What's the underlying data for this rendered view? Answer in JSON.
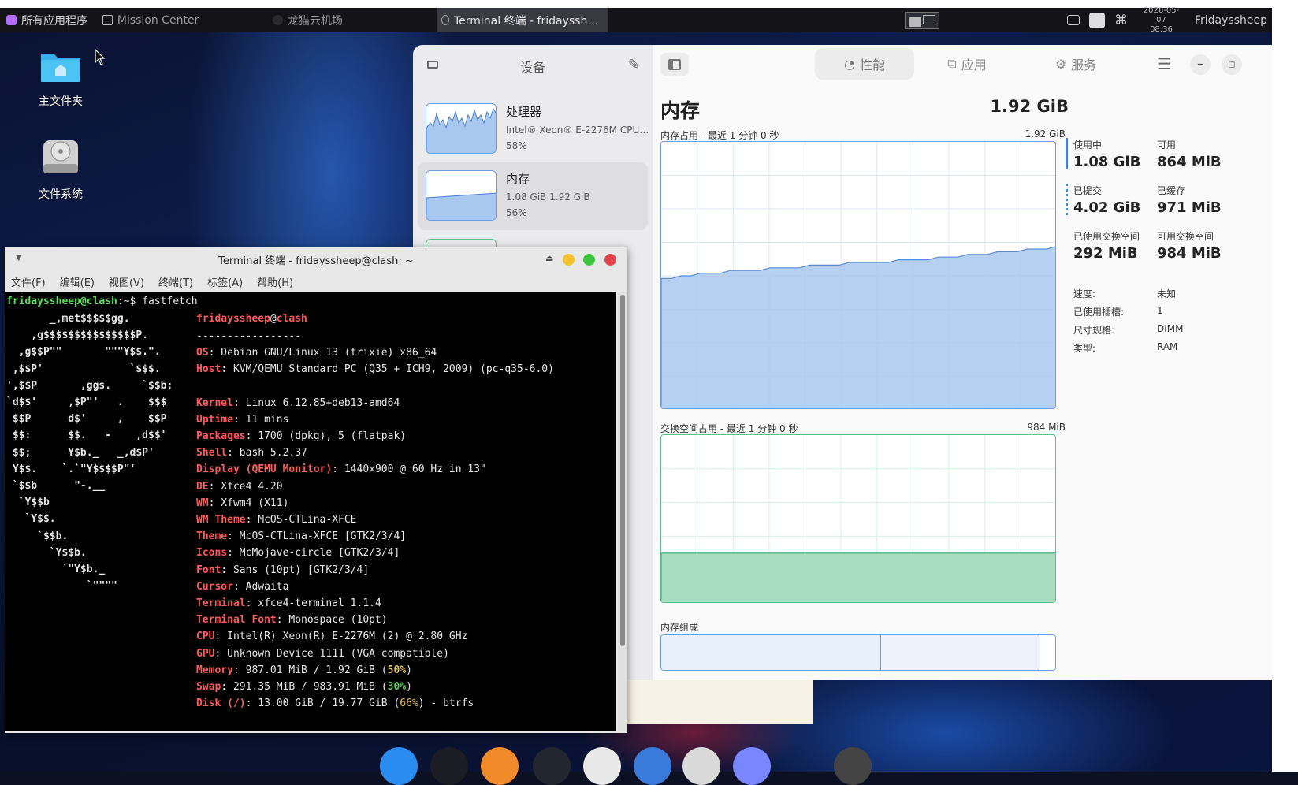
{
  "top_panel": {
    "apps_menu": "所有应用程序",
    "tasks": [
      {
        "label": "Mission Center"
      },
      {
        "label": "龙猫云机场"
      },
      {
        "label": "Terminal 终端 - fridayssheep@clash: ~"
      }
    ],
    "clock": {
      "date": "2026-05-07",
      "time": "08:36"
    },
    "user": "Fridayssheep"
  },
  "desktop": {
    "icons": [
      {
        "label": "主文件夹",
        "icon": "folder-home-icon"
      },
      {
        "label": "文件系统",
        "icon": "drive-icon"
      }
    ]
  },
  "mission_center": {
    "sidebar": {
      "title": "设备",
      "devices": [
        {
          "name": "处理器",
          "line1": "Intel® Xeon® E-2276M CPU…",
          "line2": "58%"
        },
        {
          "name": "内存",
          "line1": "1.08 GiB 1.92 GiB",
          "line2": "56%"
        }
      ]
    },
    "tabs": [
      {
        "label": "性能",
        "icon": "gauge-icon"
      },
      {
        "label": "应用",
        "icon": "apps-icon"
      },
      {
        "label": "服务",
        "icon": "gear-icon"
      }
    ],
    "page": {
      "title": "内存",
      "total": "1.92 GiB",
      "mem_graph": {
        "label": "内存占用 - 最近 1 分钟 0 秒",
        "max": "1.92 GiB"
      },
      "swap_graph": {
        "label": "交换空间占用 - 最近 1 分钟 0 秒",
        "max": "984 MiB"
      },
      "composition_label": "内存组成",
      "composition": {
        "used": 0.56,
        "cached": 0.403
      },
      "stats": [
        {
          "label": "使用中",
          "value": "1.08 GiB"
        },
        {
          "label": "可用",
          "value": "864 MiB"
        },
        {
          "label": "已提交",
          "value": "4.02 GiB"
        },
        {
          "label": "已缓存",
          "value": "971 MiB"
        },
        {
          "label": "已使用交换空间",
          "value": "292 MiB"
        },
        {
          "label": "可用交换空间",
          "value": "984 MiB"
        }
      ],
      "details": [
        {
          "label": "速度:",
          "value": "未知"
        },
        {
          "label": "已使用插槽:",
          "value": "1"
        },
        {
          "label": "尺寸规格:",
          "value": "DIMM"
        },
        {
          "label": "类型:",
          "value": "RAM"
        }
      ],
      "mem_history": [
        0.49,
        0.49,
        0.5,
        0.5,
        0.51,
        0.51,
        0.51,
        0.52,
        0.52,
        0.52,
        0.52,
        0.53,
        0.53,
        0.53,
        0.53,
        0.54,
        0.54,
        0.54,
        0.54,
        0.55,
        0.55,
        0.55,
        0.55,
        0.55,
        0.56,
        0.56,
        0.56,
        0.56,
        0.57,
        0.57,
        0.57,
        0.58,
        0.58,
        0.58,
        0.59,
        0.59,
        0.59,
        0.6,
        0.6,
        0.6,
        0.61
      ],
      "swap_level": 0.3
    }
  },
  "terminal": {
    "title": "Terminal 终端 - fridayssheep@clash: ~",
    "menu": [
      "文件(F)",
      "编辑(E)",
      "视图(V)",
      "终端(T)",
      "标签(A)",
      "帮助(H)"
    ],
    "prompt_user": "fridayssheep@clash",
    "prompt_rest": ":~$ fastfetch",
    "header_user": "fridayssheep",
    "header_at": "@",
    "header_host": "clash",
    "separator": "-----------------",
    "logo": [
      "       _,met$$$$$gg.",
      "    ,g$$$$$$$$$$$$$$$P.",
      "  ,g$$P\"\"       \"\"\"Y$$.\".",
      " ,$$P'              `$$$.",
      "',$$P       ,ggs.     `$$b:",
      "`d$$'     ,$P\"'   .    $$$",
      " $$P      d$'     ,    $$P",
      " $$:      $$.   -    ,d$$'",
      " $$;      Y$b._   _,d$P'",
      " Y$$.    `.`\"Y$$$$P\"'",
      " `$$b      \"-.__",
      "  `Y$$b",
      "   `Y$$.",
      "     `$$b.",
      "       `Y$$b.",
      "         `\"Y$b._",
      "             `\"\"\"\""
    ],
    "info": [
      {
        "k": "OS",
        "v": ": Debian GNU/Linux 13 (trixie) x86_64"
      },
      {
        "k": "Host",
        "v": ": KVM/QEMU Standard PC (Q35 + ICH9, 2009) (pc-q35-6.0)"
      },
      {
        "k": "Kernel",
        "v": ": Linux 6.12.85+deb13-amd64"
      },
      {
        "k": "Uptime",
        "v": ": 11 mins"
      },
      {
        "k": "Packages",
        "v": ": 1700 (dpkg), 5 (flatpak)"
      },
      {
        "k": "Shell",
        "v": ": bash 5.2.37"
      },
      {
        "k": "Display (QEMU Monitor)",
        "v": ": 1440x900 @ 60 Hz in 13\""
      },
      {
        "k": "DE",
        "v": ": Xfce4 4.20"
      },
      {
        "k": "WM",
        "v": ": Xfwm4 (X11)"
      },
      {
        "k": "WM Theme",
        "v": ": McOS-CTLina-XFCE"
      },
      {
        "k": "Theme",
        "v": ": McOS-CTLina-XFCE [GTK2/3/4]"
      },
      {
        "k": "Icons",
        "v": ": McMojave-circle [GTK2/3/4]"
      },
      {
        "k": "Font",
        "v": ": Sans (10pt) [GTK2/3/4]"
      },
      {
        "k": "Cursor",
        "v": ": Adwaita"
      },
      {
        "k": "Terminal",
        "v": ": xfce4-terminal 1.1.4"
      },
      {
        "k": "Terminal Font",
        "v": ": Monospace (10pt)"
      },
      {
        "k": "CPU",
        "v": ": Intel(R) Xeon(R) E-2276M (2) @ 2.80 GHz"
      },
      {
        "k": "GPU",
        "v": ": Unknown Device 1111 (VGA compatible)"
      },
      {
        "k": "Memory",
        "v": ": 987.01 MiB / 1.92 GiB (",
        "pct": "50%",
        "tail": ")"
      },
      {
        "k": "Swap",
        "v": ": 291.35 MiB / 983.91 MiB (",
        "pct": "30%",
        "tail": ")"
      },
      {
        "k": "Disk (/)",
        "v": ": 13.00 GiB / 19.77 GiB (",
        "pct": "66%",
        "tail": ") - btrfs"
      }
    ]
  },
  "dock": {
    "icons": [
      "finder-icon",
      "terminal-icon",
      "firefox-icon",
      "activity-monitor-icon",
      "window-list-icon",
      "files-icon",
      "trash-icon",
      "launcher-icon",
      "settings-icon"
    ]
  },
  "colors": {
    "accent_blue": "#6a9ce0",
    "mem_fill": "#a9c8f0",
    "swap_fill": "#a7dcc0",
    "terminal_key": "#ff5a5a",
    "terminal_green": "#57e35b"
  }
}
